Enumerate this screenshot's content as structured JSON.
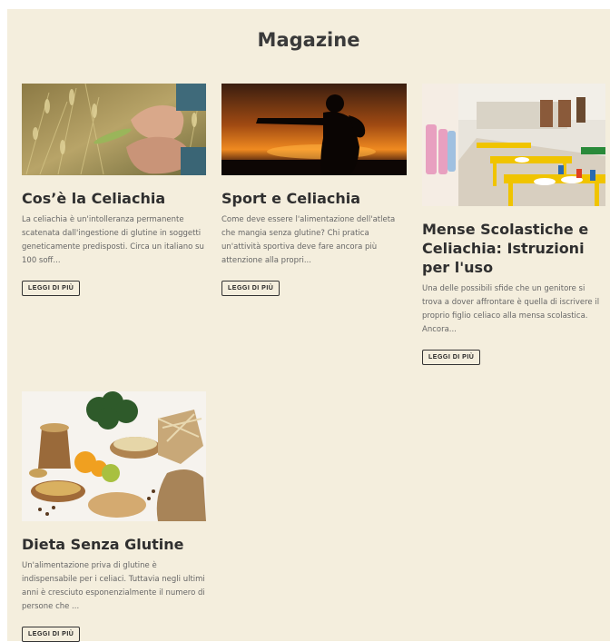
{
  "header": {
    "title": "Magazine"
  },
  "articles": [
    {
      "title": "Cos’è la Celiachia",
      "excerpt": "La celiachia è un'intolleranza permanente scatenata dall'ingestione di glutine in soggetti geneticamente predisposti. Circa un italiano su 100 soff...",
      "cta": "LEGGI DI PIÙ"
    },
    {
      "title": "Sport e Celiachia",
      "excerpt": "Come deve essere l'alimentazione dell'atleta che mangia senza glutine? Chi pratica un'attività sportiva deve fare ancora più attenzione alla propri...",
      "cta": "LEGGI DI PIÙ"
    },
    {
      "title": "Mense Scolastiche e Celiachia: Istruzioni per l'uso",
      "excerpt": "Una delle possibili sfide che un genitore si trova a dover affrontare è quella di iscrivere il proprio figlio celiaco alla mensa scolastica. Ancora...",
      "cta": "LEGGI DI PIÙ"
    },
    {
      "title": "Dieta Senza Glutine",
      "excerpt": "Un'alimentazione priva di glutine è indispensabile per i celiaci. Tuttavia negli ultimi anni è cresciuto esponenzialmente il numero di persone che ...",
      "cta": "LEGGI DI PIÙ"
    }
  ]
}
